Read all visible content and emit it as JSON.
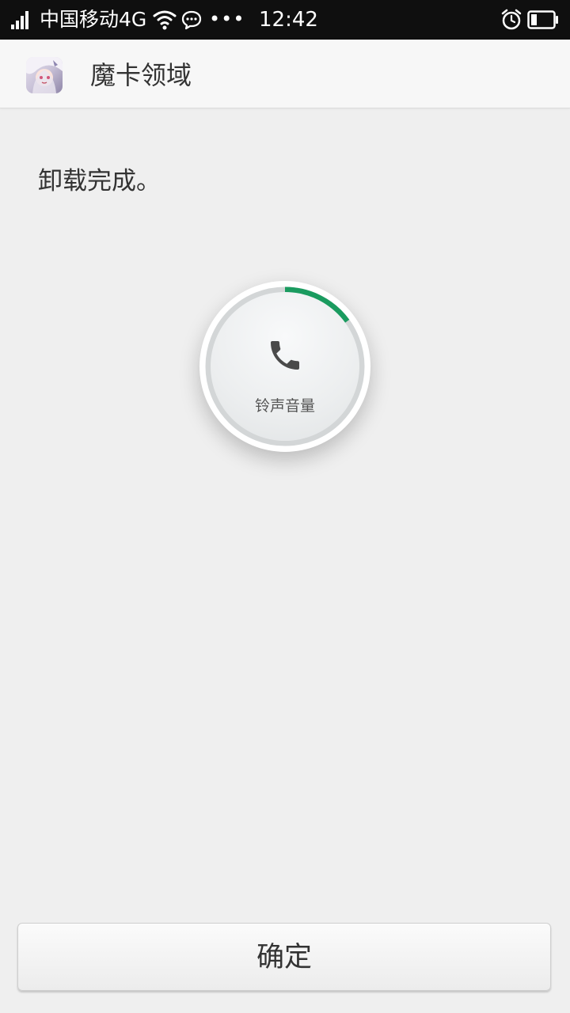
{
  "status_bar": {
    "carrier": "中国移动4G",
    "more": "•••",
    "time": "12:42",
    "icons": [
      "signal-icon",
      "wifi-icon",
      "message-icon",
      "alarm-icon",
      "battery-icon"
    ]
  },
  "app_bar": {
    "title": "魔卡领域",
    "icon": "app-icon"
  },
  "content": {
    "message": "卸载完成。"
  },
  "volume_dialog": {
    "label": "铃声音量",
    "icon": "phone-icon",
    "level": 0.15,
    "accent_color": "#1a9b5f"
  },
  "footer": {
    "confirm_label": "确定"
  }
}
